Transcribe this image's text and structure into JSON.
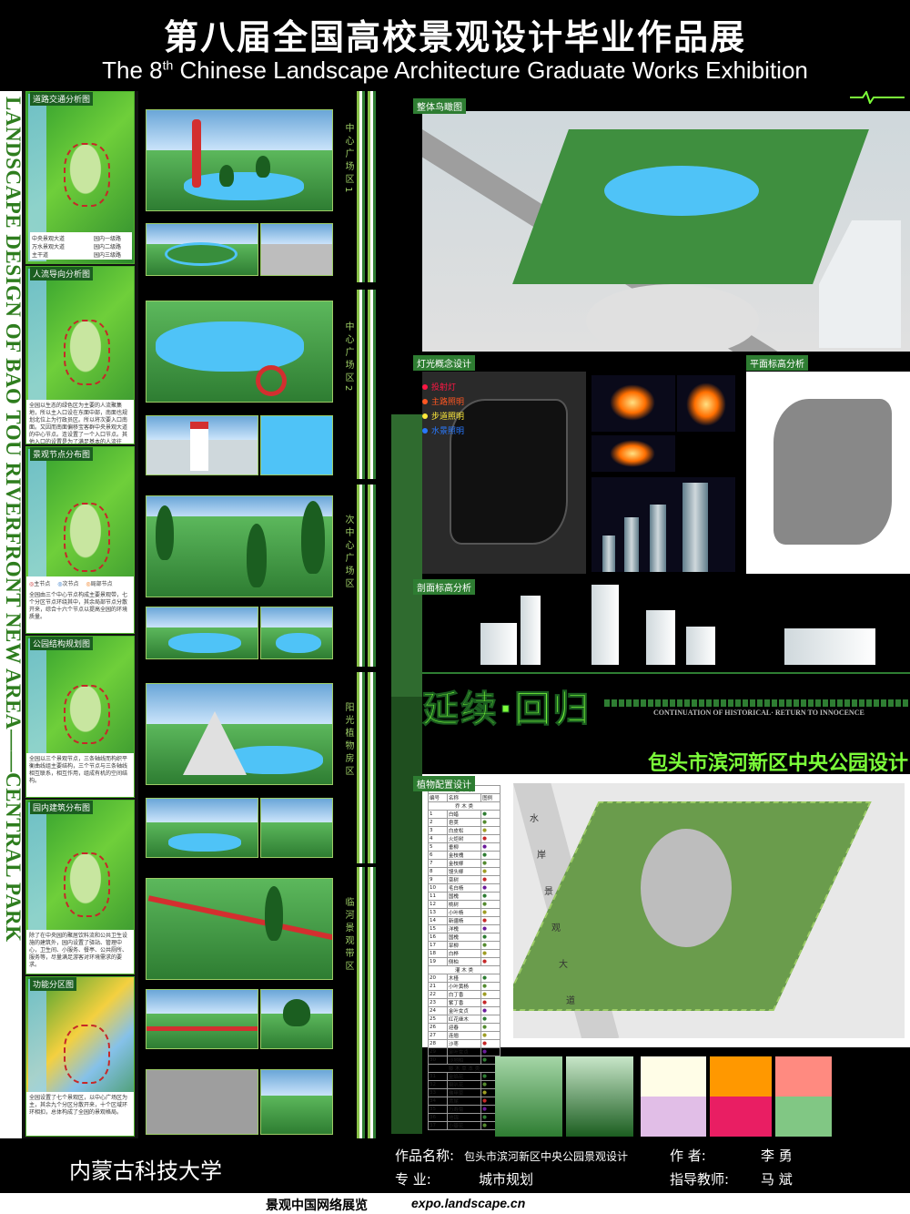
{
  "header": {
    "title_cn": "第八届全国高校景观设计毕业作品展",
    "title_en_pre": "The 8",
    "title_en_sup": "th",
    "title_en_post": " Chinese Landscape Architecture Graduate Works Exhibition"
  },
  "vertical_title": "LANDSCAPE DESIGN OF BAO TOU RIVERFRONT NEW AREA——CENTRAL PARK",
  "analysis_panels": [
    {
      "label": "道路交通分析图",
      "text": ""
    },
    {
      "label": "人流导向分析图",
      "text": "全园以生态的绿色区为主要的人流聚集地，所以主入口设在东面中部，南面也规划北位上为行政员区。所以将次要入口南面。又因而南面偏移宝客群中央景观大道的中心节点。连设置了一个入口节点。其他入口的设置是为了满足基本的人流往返。"
    },
    {
      "label": "景观节点分布图",
      "text": "全园由三个中心节点构成主要景观带，七个分区节点环绕其中，其余局部节点分散开来，综合十六个节点以提高全园的环境质量。"
    },
    {
      "label": "公园结构规划图",
      "text": "全园以三个景观节点，三条轴线而构织平衡曲线组主要结构，三个节点与三条轴线相互联系，相互作用，组成有机的空间结构。"
    },
    {
      "label": "园内建筑分布图",
      "text": "除了在中央园的聚居饮料流和公共卫生设施的建筑外，园内设置了驿站、管理中心，卫生间、小服务、餐亭、公共厕所、服务等，尽量满足游客对环境需求的要求。"
    },
    {
      "label": "功能分区图",
      "text": "全园设置了七个景观区，以中心广场区为主，其余九个分区分散开来，十个区域环环相扣，总体构成了全园的景观格局。"
    }
  ],
  "road_legend": [
    "中央景观大道",
    "万水景观大道",
    "主干道",
    "园内一级路",
    "园内二级路",
    "园内三级路"
  ],
  "zone_labels": [
    {
      "text": "中心广场区1"
    },
    {
      "text": "中心广场区2"
    },
    {
      "text": "次中心广场区"
    },
    {
      "text": "阳光植物房区"
    },
    {
      "text": "临河景观带区"
    }
  ],
  "node_legend": [
    "主节点",
    "次节点",
    "局部节点"
  ],
  "right_sections": {
    "aerial": "整体鸟瞰图",
    "lighting": "灯光概念设计",
    "height": "平面标高分析",
    "section": "剖面标高分析",
    "planting": "植物配置设计"
  },
  "light_legend": [
    {
      "label": "投射灯",
      "color": "#ff1744"
    },
    {
      "label": "主路照明",
      "color": "#ff5722"
    },
    {
      "label": "步道照明",
      "color": "#ffeb3b"
    },
    {
      "label": "水景照明",
      "color": "#2979ff"
    }
  ],
  "slogan": {
    "cn": "延续·回归",
    "en": "CONTINUATION OF HISTORICAL· RETURN TO INNOCENCE",
    "park_name": "包头市滨河新区中央公园设计"
  },
  "plant_table": {
    "header": [
      "编号",
      "名称",
      "图例"
    ],
    "title": "苗 木 表",
    "groups": [
      {
        "group": "乔 木 类",
        "rows": [
          "白蜡",
          "皂荚",
          "白皮松",
          "火炬树",
          "垂柳",
          "金枝槐",
          "金枝柳",
          "馒头柳",
          "栾树",
          "毛白杨",
          "国槐",
          "桃树",
          "小叶杨",
          "新疆杨",
          "洋槐",
          "国槐",
          "旱柳",
          "白桦",
          "侧柏"
        ]
      },
      {
        "group": "灌 木 类",
        "rows": [
          "木槿",
          "小叶黄杨",
          "白丁香",
          "紫丁香",
          "金叶女贞",
          "红花继木",
          "迎春",
          "连翘",
          "沙枣",
          "金叶女贞",
          "沙地柏"
        ]
      },
      {
        "group": "藤 木 草 本 类",
        "rows": [
          "金焰花",
          "喇叭花",
          "佛甲草",
          "鸢尾",
          "万寿菊",
          "地锦",
          "小瓣花"
        ]
      }
    ]
  },
  "map_labels": [
    "水",
    "岸",
    "景",
    "观",
    "大",
    "道"
  ],
  "footer": {
    "university": "内蒙古科技大学",
    "work_label": "作品名称:",
    "work_name": "包头市滨河新区中央公园景观设计",
    "author_label": "作      者:",
    "author_name": "李       勇",
    "major_label": "专      业:",
    "major_name": "城市规划",
    "advisor_label": "指导教师:",
    "advisor_name": "马       斌"
  },
  "bottom": {
    "site": "景观中国网络展览",
    "url": "expo.landscape.cn"
  },
  "colors": {
    "brand_green": "#2e7d32",
    "accent_green": "#7cff3a",
    "background": "#000000"
  }
}
